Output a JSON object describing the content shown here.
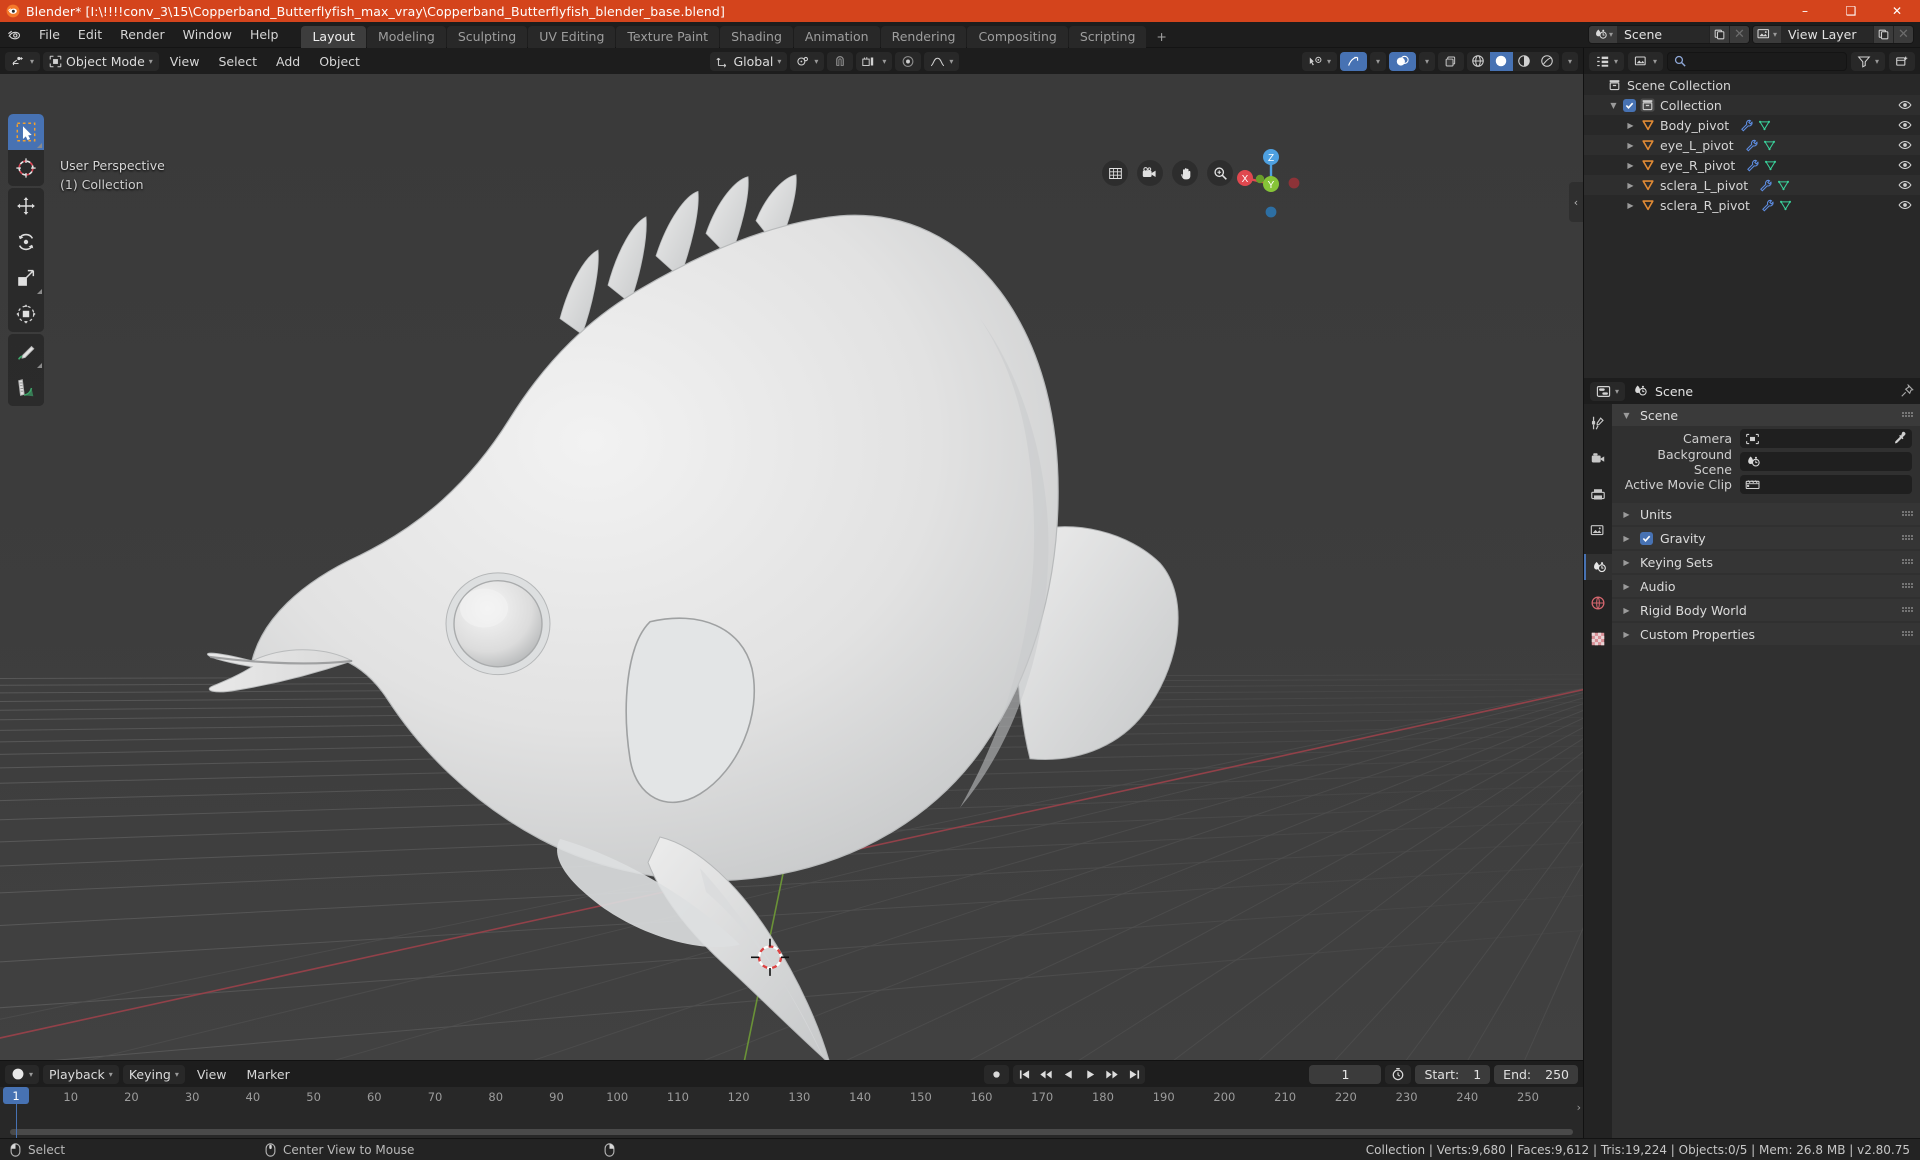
{
  "window": {
    "title": "Blender* [I:\\!!!!conv_3\\15\\Copperband_Butterflyfish_max_vray\\Copperband_Butterflyfish_blender_base.blend]",
    "minimize": "–",
    "maximize": "❑",
    "close": "✕"
  },
  "topbar": {
    "menus": [
      "File",
      "Edit",
      "Render",
      "Window",
      "Help"
    ],
    "tabs": [
      {
        "label": "Layout",
        "active": true
      },
      {
        "label": "Modeling",
        "active": false
      },
      {
        "label": "Sculpting",
        "active": false
      },
      {
        "label": "UV Editing",
        "active": false
      },
      {
        "label": "Texture Paint",
        "active": false
      },
      {
        "label": "Shading",
        "active": false
      },
      {
        "label": "Animation",
        "active": false
      },
      {
        "label": "Rendering",
        "active": false
      },
      {
        "label": "Compositing",
        "active": false
      },
      {
        "label": "Scripting",
        "active": false
      }
    ],
    "add_tab": "+",
    "scene_name": "Scene",
    "view_layer_name": "View Layer"
  },
  "viewport_header": {
    "mode": "Object Mode",
    "menus": [
      "View",
      "Select",
      "Add",
      "Object"
    ],
    "transform_orientation": "Global",
    "snap_on": false,
    "proportional_on": false
  },
  "viewport": {
    "perspective": "User Perspective",
    "collection": "(1) Collection",
    "gizmo_axes": {
      "x": "X",
      "y": "Y",
      "z": "Z"
    },
    "tools": [
      "select-box-tool",
      "cursor-tool",
      "move-tool",
      "rotate-tool",
      "scale-tool",
      "transform-tool",
      "annotate-tool",
      "measure-tool"
    ],
    "nav_icons": [
      "grid-toggle-icon",
      "camera-view-icon",
      "pan-view-icon",
      "zoom-view-icon"
    ],
    "side_arrow": "‹"
  },
  "timeline": {
    "menus": [
      "Playback",
      "Keying",
      "View",
      "Marker"
    ],
    "current_frame": "1",
    "start_label": "Start:",
    "start_value": "1",
    "end_label": "End:",
    "end_value": "250",
    "ticks": [
      "10",
      "20",
      "30",
      "40",
      "50",
      "60",
      "70",
      "80",
      "90",
      "100",
      "110",
      "120",
      "130",
      "140",
      "150",
      "160",
      "170",
      "180",
      "190",
      "200",
      "210",
      "220",
      "230",
      "240",
      "250"
    ],
    "playhead_label": "1"
  },
  "outliner": {
    "search_placeholder": "",
    "rows": [
      {
        "label": "Scene Collection",
        "depth": 0,
        "icon": "collection-icon",
        "disclosure": "",
        "checkbox": false,
        "eye": false,
        "modifiers": false
      },
      {
        "label": "Collection",
        "depth": 1,
        "icon": "collection-icon",
        "disclosure": "▼",
        "checkbox": true,
        "eye": true,
        "modifiers": false
      },
      {
        "label": "Body_pivot",
        "depth": 2,
        "icon": "empty-axes-icon",
        "disclosure": "▶",
        "checkbox": false,
        "eye": true,
        "modifiers": true
      },
      {
        "label": "eye_L_pivot",
        "depth": 2,
        "icon": "empty-axes-icon",
        "disclosure": "▶",
        "checkbox": false,
        "eye": true,
        "modifiers": true
      },
      {
        "label": "eye_R_pivot",
        "depth": 2,
        "icon": "empty-axes-icon",
        "disclosure": "▶",
        "checkbox": false,
        "eye": true,
        "modifiers": true
      },
      {
        "label": "sclera_L_pivot",
        "depth": 2,
        "icon": "empty-axes-icon",
        "disclosure": "▶",
        "checkbox": false,
        "eye": true,
        "modifiers": true
      },
      {
        "label": "sclera_R_pivot",
        "depth": 2,
        "icon": "empty-axes-icon",
        "disclosure": "▶",
        "checkbox": false,
        "eye": true,
        "modifiers": true
      }
    ]
  },
  "properties": {
    "breadcrumb": "Scene",
    "tabs": [
      "tool-icon",
      "render-icon",
      "output-icon",
      "view-layer-icon",
      "scene-icon",
      "world-icon",
      "texture-icon"
    ],
    "active_tab_index": 4,
    "panel_scene": "Scene",
    "fields": [
      {
        "label": "Camera",
        "value": "",
        "icon": "camera-data-icon",
        "eyedropper": true
      },
      {
        "label": "Background Scene",
        "value": "",
        "icon": "scene-data-icon",
        "eyedropper": false
      },
      {
        "label": "Active Movie Clip",
        "value": "",
        "icon": "movieclip-icon",
        "eyedropper": false
      }
    ],
    "sections": [
      {
        "label": "Units",
        "checkbox": false
      },
      {
        "label": "Gravity",
        "checkbox": true
      },
      {
        "label": "Keying Sets",
        "checkbox": false
      },
      {
        "label": "Audio",
        "checkbox": false
      },
      {
        "label": "Rigid Body World",
        "checkbox": false
      },
      {
        "label": "Custom Properties",
        "checkbox": false
      }
    ]
  },
  "statusbar": {
    "left_action": "Select",
    "mid_action": "Center View to Mouse",
    "stats": "Collection | Verts:9,680 | Faces:9,612 | Tris:19,224 | Objects:0/5 | Mem: 26.8 MB | v2.80.75"
  },
  "colors": {
    "accent": "#4772b3",
    "title_bar": "#d4441c",
    "axis_x": "#e0484f",
    "axis_y": "#86c438",
    "axis_z": "#4ea0e0",
    "empty_orange": "#e08a35",
    "mesh_green": "#3ad09a",
    "modifier_blue": "#5d8ce0"
  }
}
